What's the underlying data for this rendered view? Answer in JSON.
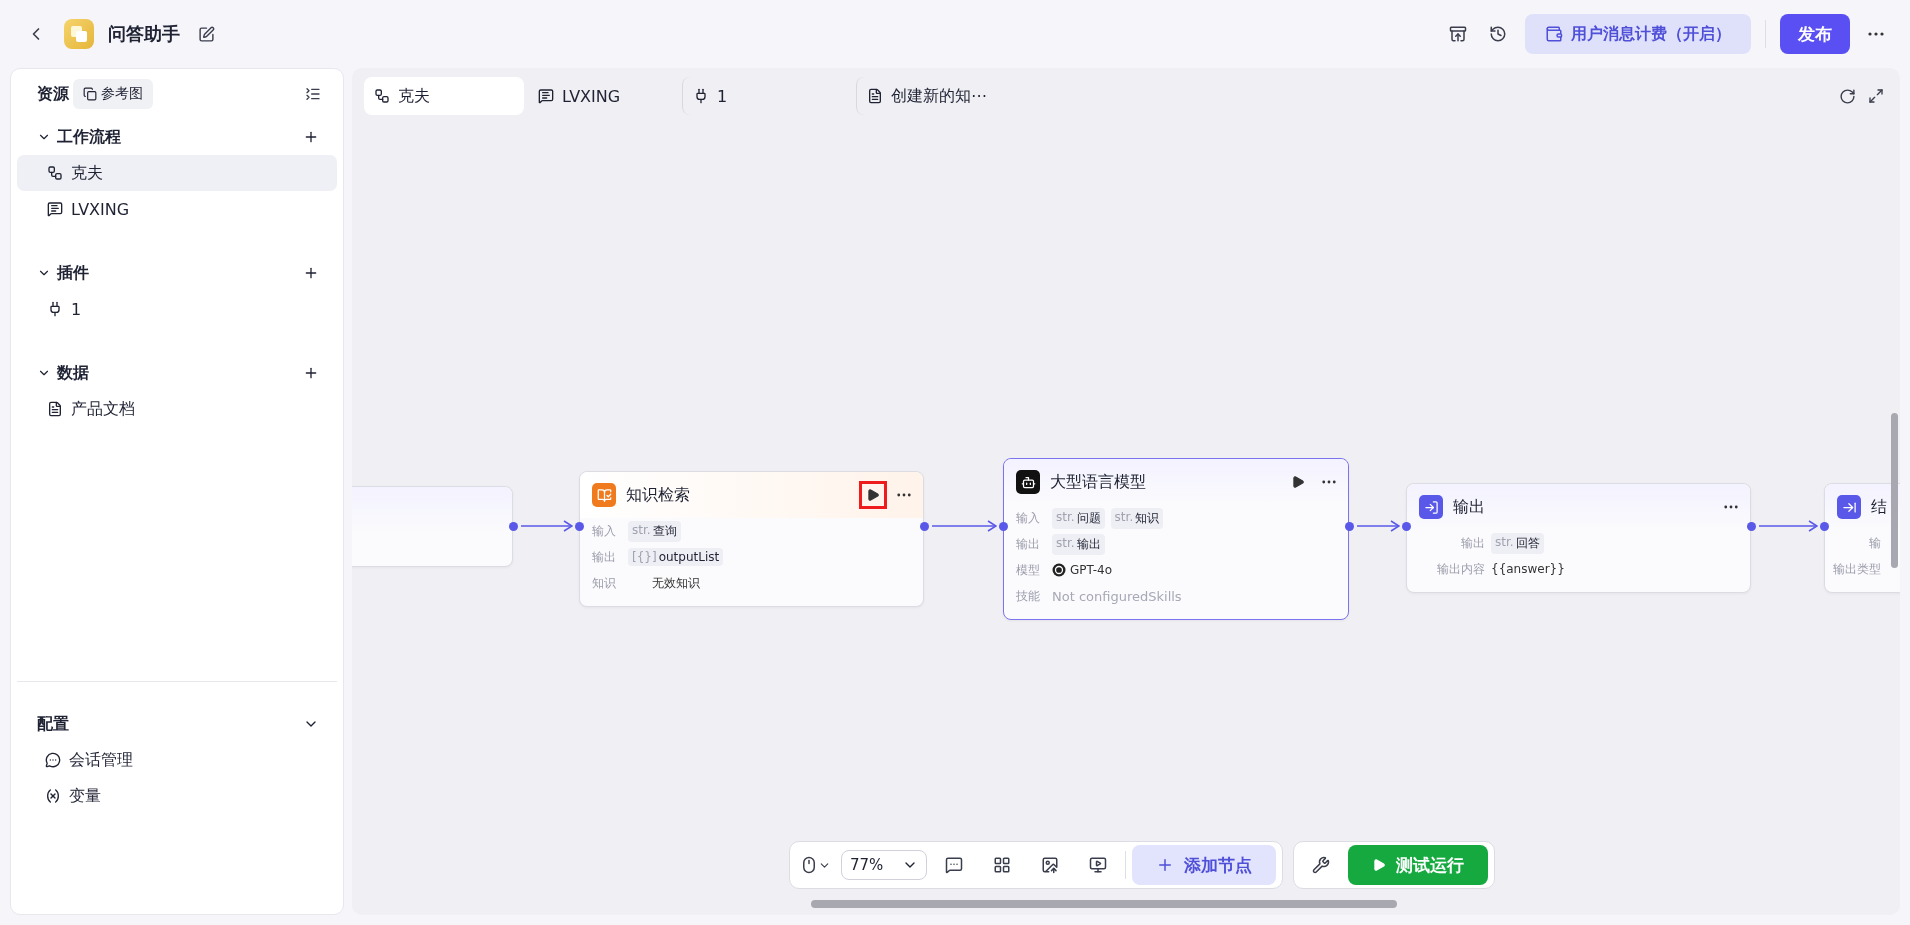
{
  "app": {
    "title": "问答助手"
  },
  "header": {
    "billing": "用户消息计费（开启）",
    "publish": "发布"
  },
  "sidebar": {
    "title": "资源",
    "reference_button": "参考图",
    "sections": [
      {
        "title": "工作流程",
        "items": [
          {
            "label": "克夫",
            "kind": "workflow",
            "selected": true
          },
          {
            "label": "LVXING",
            "kind": "chat",
            "selected": false
          }
        ]
      },
      {
        "title": "插件",
        "items": [
          {
            "label": "1",
            "kind": "plugin",
            "selected": false
          }
        ]
      },
      {
        "title": "数据",
        "items": [
          {
            "label": "产品文档",
            "kind": "doc",
            "selected": false
          }
        ]
      }
    ],
    "config": {
      "title": "配置",
      "items": [
        {
          "label": "会话管理",
          "kind": "session"
        },
        {
          "label": "变量",
          "kind": "variable"
        }
      ]
    }
  },
  "tabs": [
    {
      "label": "克夫",
      "kind": "workflow",
      "selected": true
    },
    {
      "label": "LVXING",
      "kind": "chat",
      "selected": false
    },
    {
      "label": "1",
      "kind": "plugin",
      "selected": false
    },
    {
      "label": "创建新的知⋯",
      "kind": "doc",
      "selected": false
    }
  ],
  "nodes": [
    {
      "kind": "start",
      "selected": false
    },
    {
      "kind": "knowledge",
      "title": "知识检索",
      "run": true,
      "run_highlighted": true,
      "selected": false,
      "rows": [
        {
          "label": "输入",
          "tags": [
            {
              "type": "str.",
              "text": "查询"
            }
          ]
        },
        {
          "label": "输出",
          "tags": [
            {
              "type": "[{}]",
              "text": "outputList"
            }
          ]
        },
        {
          "label": "知识",
          "value": "无效知识",
          "muted": false
        }
      ]
    },
    {
      "kind": "llm",
      "title": "大型语言模型",
      "run": true,
      "run_highlighted": false,
      "selected": true,
      "rows": [
        {
          "label": "输入",
          "tags": [
            {
              "type": "str.",
              "text": "问题"
            },
            {
              "type": "str.",
              "text": "知识"
            }
          ]
        },
        {
          "label": "输出",
          "tags": [
            {
              "type": "str.",
              "text": "输出"
            }
          ]
        },
        {
          "label": "模型",
          "value": "GPT-4o",
          "model": true,
          "muted": false
        },
        {
          "label": "技能",
          "value": "Not configuredSkills",
          "muted": true
        }
      ]
    },
    {
      "kind": "output",
      "title": "输出",
      "run": false,
      "selected": false,
      "rows": [
        {
          "label": "输出",
          "tags": [
            {
              "type": "str.",
              "text": "回答"
            }
          ]
        },
        {
          "label": "输出内容",
          "value": "{{answer}}",
          "muted": false
        }
      ]
    },
    {
      "kind": "end",
      "title": "结",
      "run": false,
      "selected": false,
      "rows": [
        {
          "label": "输"
        },
        {
          "label": "输出类型"
        }
      ]
    }
  ],
  "toolbar": {
    "zoom": "77%",
    "add_node": "添加节点",
    "test_run": "测试运行"
  }
}
